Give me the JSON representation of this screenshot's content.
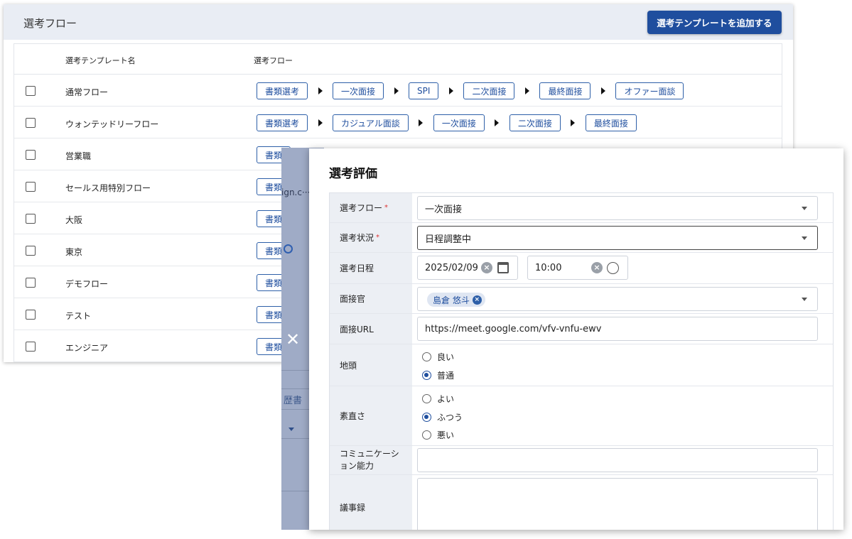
{
  "background_page": {
    "title": "選考フロー",
    "add_button_label": "選考テンプレートを追加する",
    "table": {
      "col_name": "選考テンプレート名",
      "col_flow": "選考フロー",
      "rows": [
        {
          "name": "通常フロー",
          "steps": [
            "書類選考",
            "一次面接",
            "SPI",
            "二次面接",
            "最終面接",
            "オファー面談"
          ]
        },
        {
          "name": "ウォンテッドリーフロー",
          "steps": [
            "書類選考",
            "カジュアル面談",
            "一次面接",
            "二次面接",
            "最終面接"
          ]
        },
        {
          "name": "営業職",
          "steps": [
            "書類"
          ]
        },
        {
          "name": "セールス用特別フロー",
          "steps": [
            "書類"
          ]
        },
        {
          "name": "大阪",
          "steps": [
            "書類"
          ]
        },
        {
          "name": "東京",
          "steps": [
            "書類"
          ]
        },
        {
          "name": "デモフロー",
          "steps": [
            "書類"
          ]
        },
        {
          "name": "テスト",
          "steps": [
            "書類"
          ]
        },
        {
          "name": "エンジニア",
          "steps": [
            "書類"
          ]
        }
      ]
    }
  },
  "drawer": {
    "text_url": "ign.c···",
    "text_resume": "歴書",
    "close_icon": "close-icon"
  },
  "dialog": {
    "title": "選考評価",
    "fields": {
      "flow": {
        "label": "選考フロー",
        "required": "*",
        "value": "一次面接"
      },
      "status": {
        "label": "選考状況",
        "required": "*",
        "value": "日程調整中"
      },
      "date": {
        "label": "選考日程",
        "date_value": "2025/02/09",
        "time_value": "10:00"
      },
      "interviewer": {
        "label": "面接官",
        "chip": "島倉 悠斗"
      },
      "url": {
        "label": "面接URL",
        "value": "https://meet.google.com/vfv-vnfu-ewv"
      },
      "jiatama": {
        "label": "地頭",
        "options": [
          "良い",
          "普通"
        ],
        "selected": "普通"
      },
      "sunao": {
        "label": "素直さ",
        "options": [
          "よい",
          "ふつう",
          "悪い"
        ],
        "selected": "ふつう"
      },
      "communication": {
        "label": "コミュニケーション能力",
        "value": ""
      },
      "minutes": {
        "label": "議事録",
        "value": ""
      }
    }
  },
  "colors": {
    "accent": "#1f4e9e",
    "label_bg": "#eceff4",
    "header_bg": "#e9edf4"
  }
}
